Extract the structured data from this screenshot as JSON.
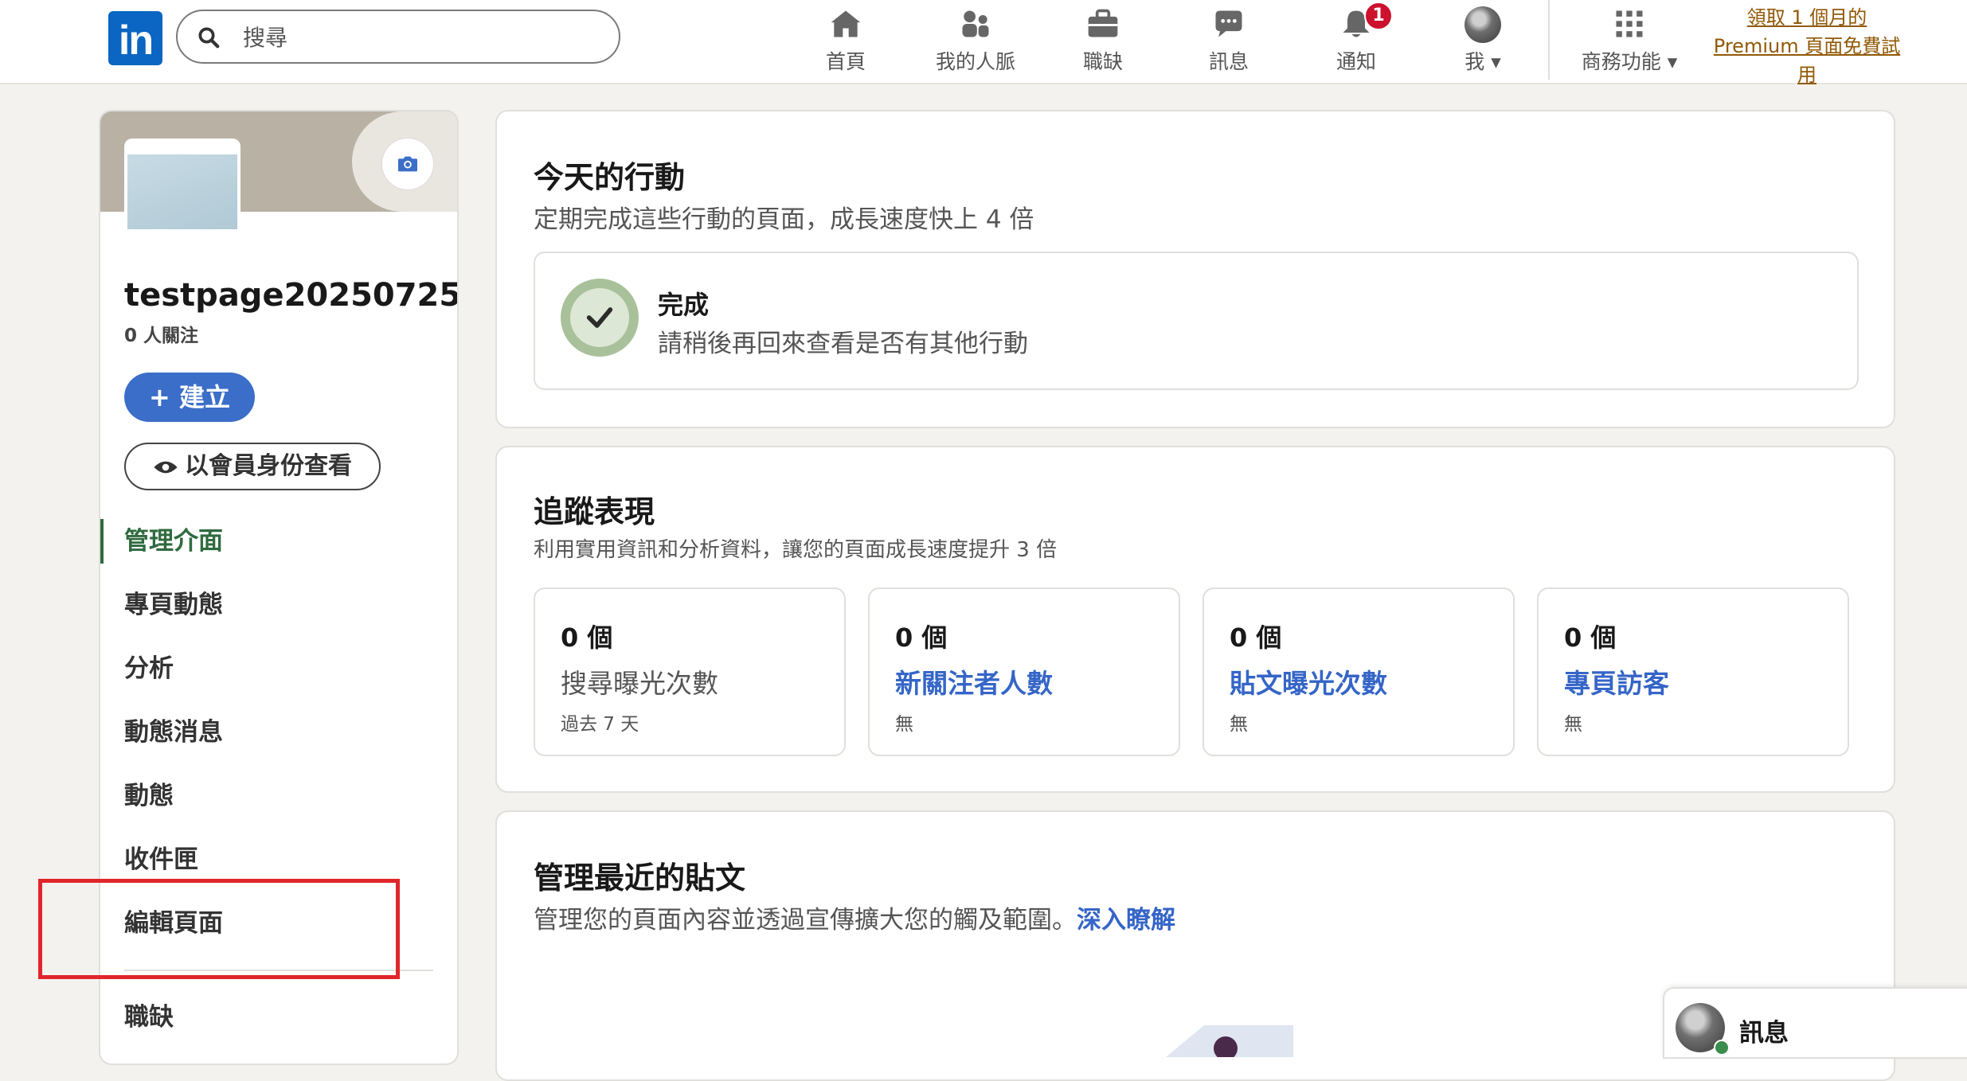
{
  "nav": {
    "logo": "in",
    "search_placeholder": "搜尋",
    "items": [
      {
        "label": "首頁",
        "icon": "home-icon"
      },
      {
        "label": "我的人脈",
        "icon": "network-icon"
      },
      {
        "label": "職缺",
        "icon": "jobs-icon"
      },
      {
        "label": "訊息",
        "icon": "messaging-icon"
      },
      {
        "label": "通知",
        "icon": "bell-icon",
        "badge": "1"
      },
      {
        "label": "我",
        "icon": "avatar"
      },
      {
        "label": "商務功能",
        "icon": "grid-icon"
      }
    ],
    "premium": "領取 1 個月的 Premium 頁面免費試用"
  },
  "sidebar": {
    "page_name": "testpage20250725",
    "followers": "0 人關注",
    "create_label": "建立",
    "view_as_member_label": "以會員身份查看",
    "menu": [
      {
        "label": "管理介面",
        "active": true
      },
      {
        "label": "專頁動態"
      },
      {
        "label": "分析"
      },
      {
        "label": "動態消息"
      },
      {
        "label": "動態"
      },
      {
        "label": "收件匣"
      },
      {
        "label": "編輯頁面"
      },
      {
        "label": "職缺"
      }
    ]
  },
  "today": {
    "title": "今天的行動",
    "subtitle": "定期完成這些行動的頁面，成長速度快上 4 倍",
    "done_title": "完成",
    "done_sub": "請稍後再回來查看是否有其他行動"
  },
  "performance": {
    "title": "追蹤表現",
    "subtitle": "利用實用資訊和分析資料，讓您的頁面成長速度提升 3 倍",
    "stats": [
      {
        "value": "0 個",
        "label": "搜尋曝光次數",
        "note": "過去 7 天",
        "link": false
      },
      {
        "value": "0 個",
        "label": "新關注者人數",
        "note": "無",
        "link": true
      },
      {
        "value": "0 個",
        "label": "貼文曝光次數",
        "note": "無",
        "link": true
      },
      {
        "value": "0 個",
        "label": "專頁訪客",
        "note": "無",
        "link": true
      }
    ]
  },
  "recent_posts": {
    "title": "管理最近的貼文",
    "subtitle": "管理您的頁面內容並透過宣傳擴大您的觸及範圍。",
    "learn_more": "深入瞭解"
  },
  "messaging": {
    "label": "訊息"
  },
  "colors": {
    "brand": "#0a66c2",
    "accent_blue": "#3565c7",
    "active_green": "#2f6b3f",
    "premium_gold": "#915907",
    "highlight_red": "#e0262b"
  }
}
